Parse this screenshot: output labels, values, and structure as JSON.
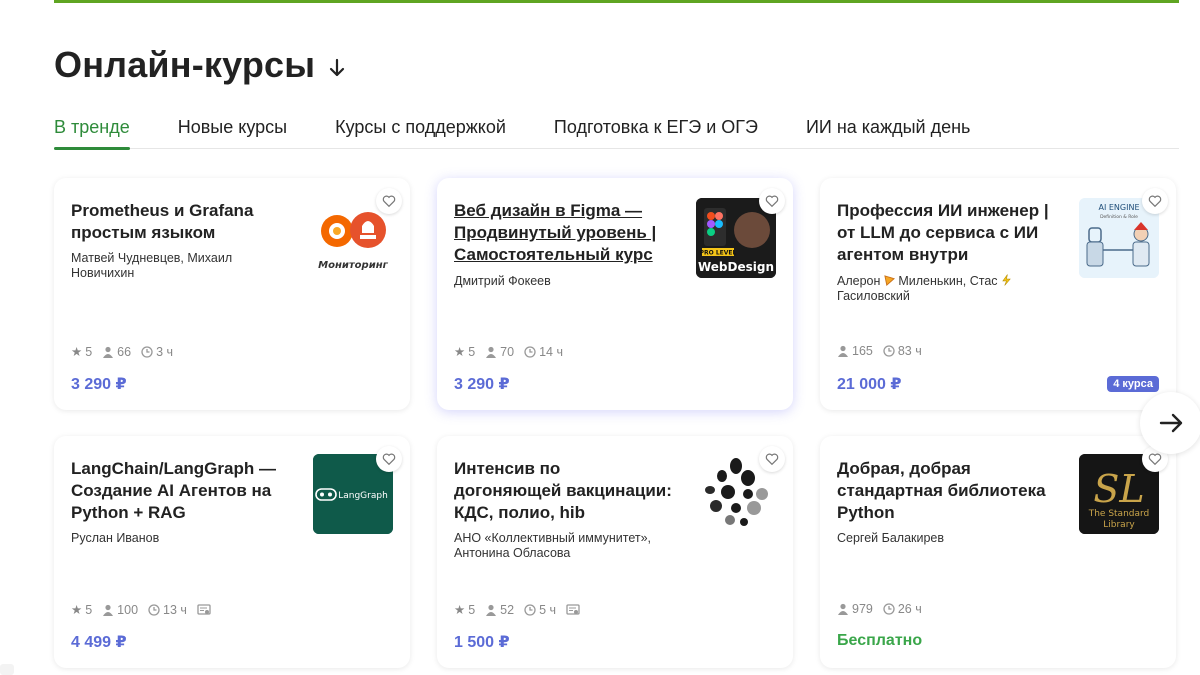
{
  "section": {
    "title": "Онлайн-курсы"
  },
  "tabs": [
    {
      "label": "В тренде",
      "active": true
    },
    {
      "label": "Новые курсы"
    },
    {
      "label": "Курсы с поддержкой"
    },
    {
      "label": "Подготовка к ЕГЭ и ОГЭ"
    },
    {
      "label": "ИИ на каждый день"
    }
  ],
  "colors": {
    "accent_green": "#2e8b3a",
    "price_blue": "#5b6bd6",
    "free_green": "#3aa64a",
    "top_bar": "#5fa522"
  },
  "thumbs": {
    "prom": {
      "text": "Мониторинг"
    },
    "figma": {
      "line1": "PRO LEVEL",
      "line2": "WebDesign"
    },
    "ai": {
      "line1": "AI ENGINE",
      "line2": "Definition & Role"
    },
    "langgraph": {
      "text": "LangGraph"
    },
    "stdlib": {
      "line1": "The Standard",
      "line2": "Library"
    }
  },
  "cards": [
    {
      "title": "Prometheus и Grafana простым языком",
      "authors": "Матвей Чудневцев, Михаил Новичихин",
      "rating": "5",
      "students": "66",
      "duration": "3 ч",
      "price": "3 290 ₽",
      "thumb_icon": "prometheus-grafana-logo"
    },
    {
      "title": "Веб дизайн в Figma — Продвинутый уровень | Самостоятельный курс",
      "authors": "Дмитрий Фокеев",
      "rating": "5",
      "students": "70",
      "duration": "14 ч",
      "price": "3 290 ₽",
      "thumb_icon": "figma-webdesign-cover"
    },
    {
      "title": "Профессия ИИ инженер | от LLM до сервиса с ИИ агентом внутри",
      "authors": "Алерон",
      "authors_mid": "Миленькин, Стас",
      "authors_tail": "Гасиловский",
      "students": "165",
      "duration": "83 ч",
      "price": "21 000 ₽",
      "badge": "4 курса",
      "thumb_icon": "ai-engineer-cover"
    },
    {
      "title": "LangChain/LangGraph — Создание AI Агентов на Python + RAG",
      "authors": "Руслан Иванов",
      "rating": "5",
      "students": "100",
      "duration": "13 ч",
      "price": "4 499 ₽",
      "thumb_icon": "langgraph-logo"
    },
    {
      "title": "Интенсив по догоняющей вакцинации: КДС, полио, hib",
      "authors": "АНО «Коллективный иммунитет», Антонина Обласова",
      "rating": "5",
      "students": "52",
      "duration": "5 ч",
      "price": "1 500 ₽",
      "thumb_icon": "dots-logo"
    },
    {
      "title": "Добрая, добрая стандартная библиотека Python",
      "authors": "Сергей Балакирев",
      "students": "979",
      "duration": "26 ч",
      "price": "Бесплатно",
      "thumb_icon": "standard-library-cover"
    }
  ]
}
